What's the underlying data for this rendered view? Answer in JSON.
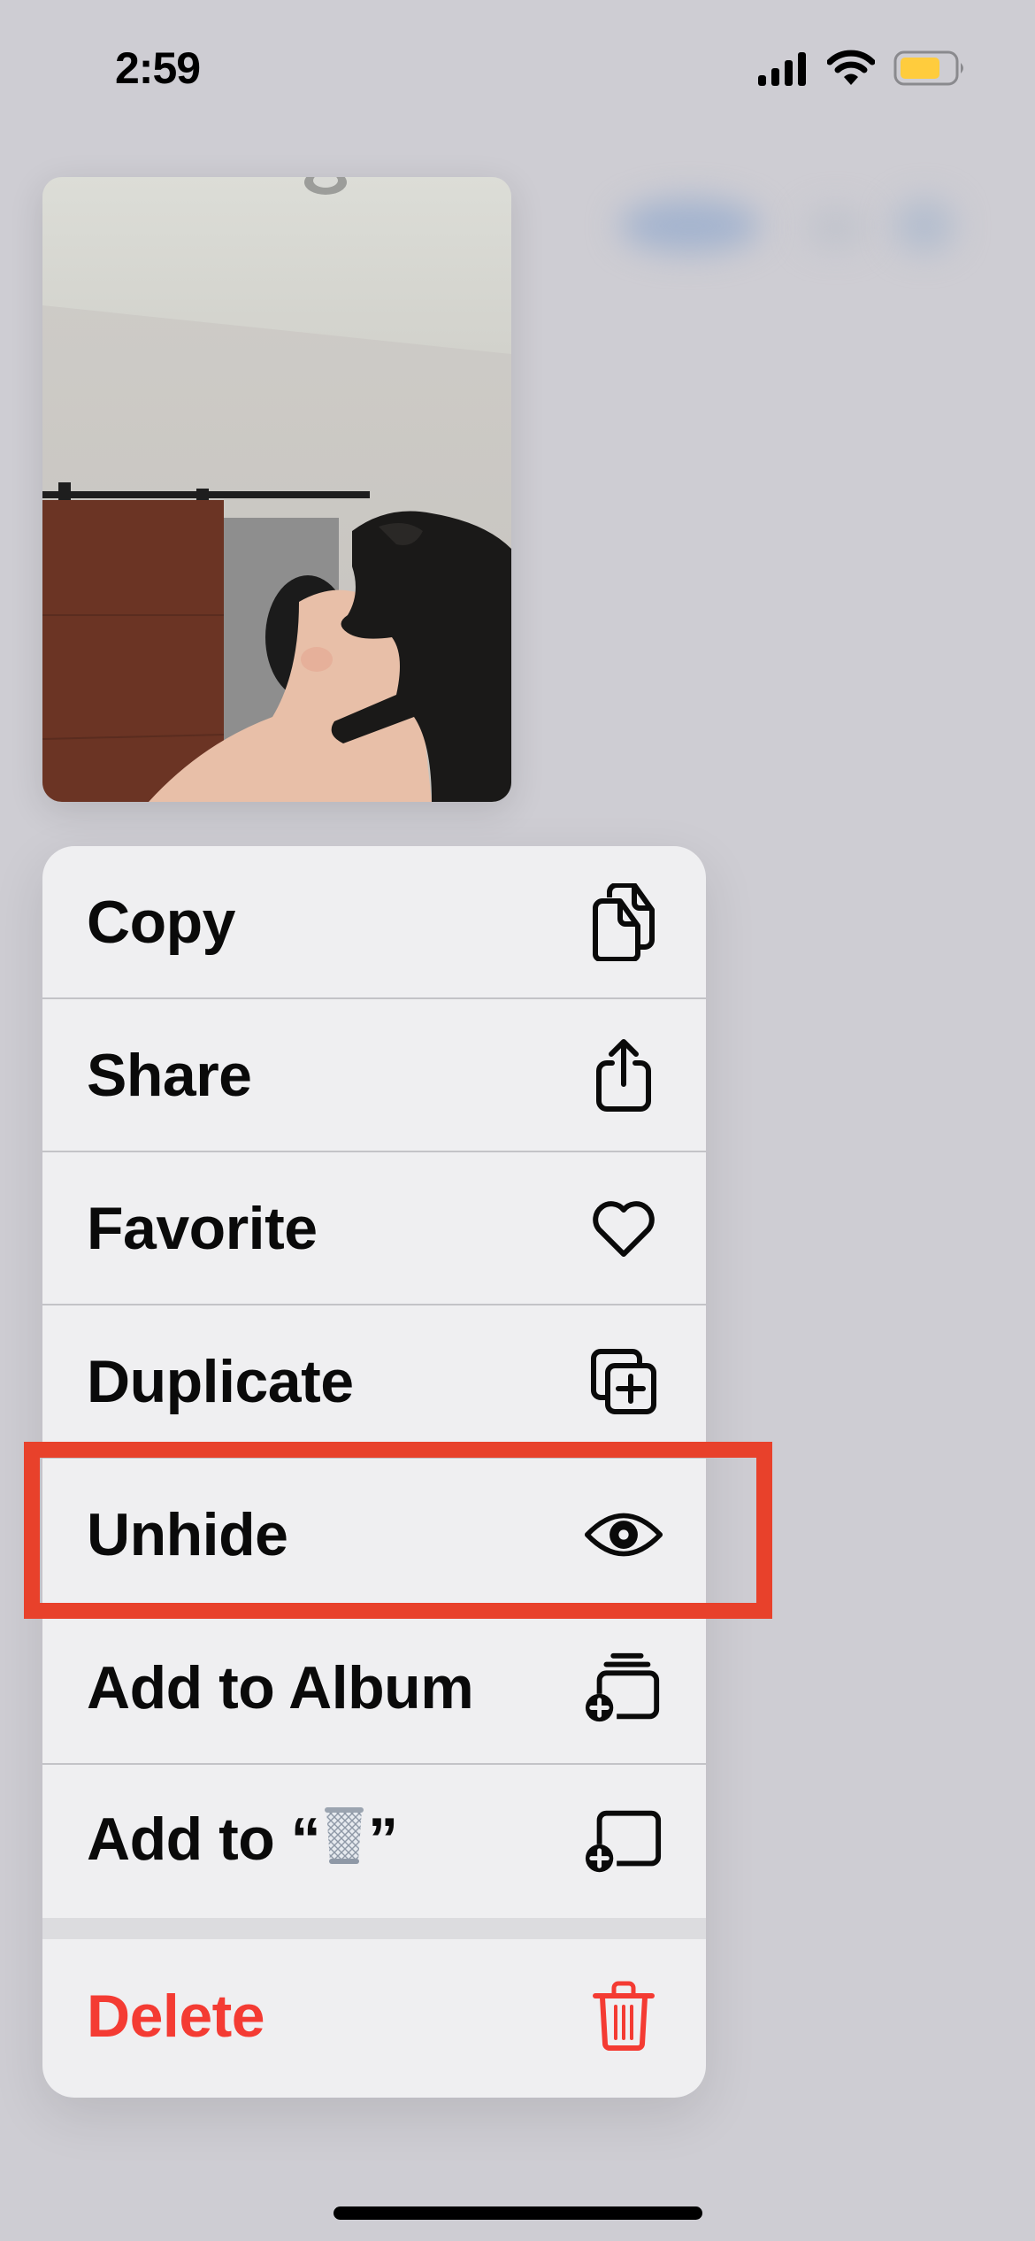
{
  "status_bar": {
    "time": "2:59",
    "icons": [
      "signal-icon",
      "wifi-icon",
      "battery-icon"
    ],
    "battery_color": "#FFCC3D"
  },
  "preview": {
    "description": "Photo of a black dog resting on a person's shoulder, sliding barn door in background"
  },
  "context_menu": {
    "items": [
      {
        "label": "Copy",
        "icon": "copy-icon"
      },
      {
        "label": "Share",
        "icon": "share-icon"
      },
      {
        "label": "Favorite",
        "icon": "heart-icon"
      },
      {
        "label": "Duplicate",
        "icon": "duplicate-icon"
      },
      {
        "label": "Unhide",
        "icon": "eye-icon",
        "highlighted": true
      },
      {
        "label": "Add to Album",
        "icon": "add-to-album-icon"
      },
      {
        "label_prefix": "Add to “",
        "label_emoji": "🗑️",
        "label_suffix": "”",
        "icon": "add-to-collection-icon"
      }
    ],
    "destructive_item": {
      "label": "Delete",
      "icon": "trash-icon",
      "color": "#F43B33"
    }
  },
  "annotation": {
    "highlight_color": "#E8412B",
    "target": "Unhide"
  }
}
